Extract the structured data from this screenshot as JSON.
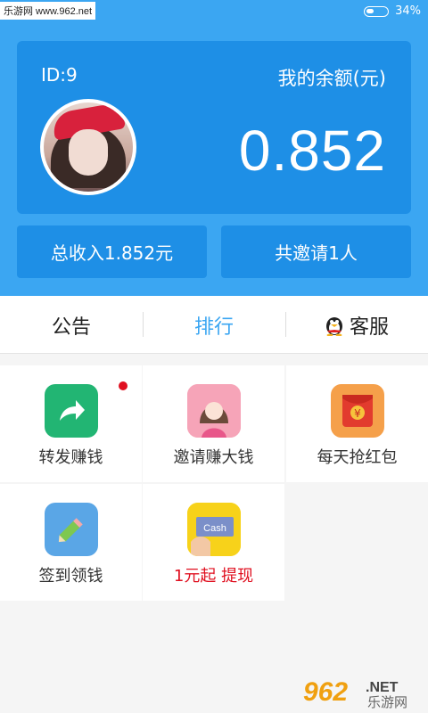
{
  "status": {
    "site": "乐游网 www.962.net",
    "battery": "34%"
  },
  "account": {
    "id": "ID:9",
    "balance_label": "我的余额(元)",
    "balance": "0.852"
  },
  "stats": {
    "total_income": "总收入1.852元",
    "invites": "共邀请1人"
  },
  "tabs": [
    "公告",
    "排行",
    "客服"
  ],
  "grid": [
    {
      "label": "转发赚钱",
      "icon": "share-arrow-icon",
      "color": "#22b573"
    },
    {
      "label": "邀请赚大钱",
      "icon": "invite-girl-icon",
      "color": "#f6a4b8"
    },
    {
      "label": "每天抢红包",
      "icon": "red-envelope-icon",
      "color": "#f5a04a"
    },
    {
      "label": "签到领钱",
      "icon": "pencil-icon",
      "color": "#5aa6e6"
    },
    {
      "label": "1元起 提现",
      "icon": "cash-icon",
      "color": "#f7d21a"
    }
  ],
  "colors": {
    "primary": "#3ba6f2",
    "card": "#1e8fe6",
    "accent_text": "#e01020"
  },
  "watermark": {
    "number": "962",
    "suffix": ".NET",
    "name": "乐游网"
  }
}
